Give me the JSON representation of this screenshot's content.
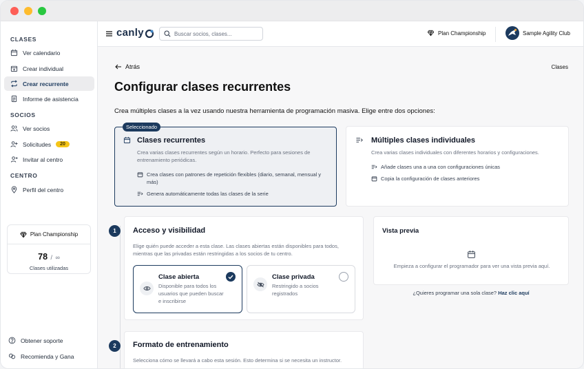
{
  "window": {
    "dots": [
      "#fe5f57",
      "#febc2e",
      "#29c840"
    ]
  },
  "brand": {
    "name": "canly"
  },
  "search": {
    "placeholder": "Buscar socios, clases..."
  },
  "topbar": {
    "plan_label": "Plan Championship",
    "club_name": "Sample Agility Club"
  },
  "sidebar": {
    "sections": [
      {
        "title": "CLASES",
        "items": [
          {
            "label": "Ver calendario",
            "icon": "calendar-icon"
          },
          {
            "label": "Crear individual",
            "icon": "calendar-plus-icon"
          },
          {
            "label": "Crear recurrente",
            "icon": "repeat-icon",
            "active": true
          },
          {
            "label": "Informe de asistencia",
            "icon": "report-icon"
          }
        ]
      },
      {
        "title": "SOCIOS",
        "items": [
          {
            "label": "Ver socios",
            "icon": "users-icon"
          },
          {
            "label": "Solicitudes",
            "icon": "user-plus-icon",
            "badge": "20"
          },
          {
            "label": "Invitar al centro",
            "icon": "user-add-icon"
          }
        ]
      },
      {
        "title": "CENTRO",
        "items": [
          {
            "label": "Perfil del centro",
            "icon": "location-pin-icon"
          }
        ]
      }
    ],
    "plan": {
      "name": "Plan Championship",
      "used": "78",
      "limit": "∞",
      "separator": "/",
      "caption": "Clases utilizadas"
    },
    "footer": [
      {
        "label": "Obtener soporte",
        "icon": "help-icon"
      },
      {
        "label": "Recomienda y Gana",
        "icon": "gift-icon"
      }
    ]
  },
  "page": {
    "back_label": "Atrás",
    "breadcrumb": "Clases",
    "title": "Configurar clases recurrentes",
    "intro": "Crea múltiples clases a la vez usando nuestra herramienta de programación masiva. Elige entre dos opciones:",
    "options": [
      {
        "selected_badge": "Seleccionado",
        "title": "Clases recurrentes",
        "desc": "Crea varias clases recurrentes según un horario. Perfecto para sesiones de entrenamiento periódicas.",
        "bullets": [
          "Crea clases con patrones de repetición flexibles (diario, semanal, mensual y más)",
          "Genera automáticamente todas las clases de la serie"
        ]
      },
      {
        "title": "Múltiples clases individuales",
        "desc": "Crea varias clases individuales con diferentes horarios y configuraciones.",
        "bullets": [
          "Añade clases una a una con configuraciones únicas",
          "Copia la configuración de clases anteriores"
        ]
      }
    ],
    "access": {
      "step": "1",
      "title": "Acceso y visibilidad",
      "desc": "Elige quién puede acceder a esta clase. Las clases abiertas están disponibles para todos, mientras que las privadas están restringidas a los socios de tu centro.",
      "choices": [
        {
          "title": "Clase abierta",
          "desc": "Disponible para todos los usuarios que pueden buscar e inscribirse",
          "selected": true
        },
        {
          "title": "Clase privada",
          "desc": "Restringido a socios registrados",
          "selected": false
        }
      ]
    },
    "preview": {
      "title": "Vista previa",
      "empty_text": "Empieza a configurar el programador para ver una vista previa aquí.",
      "question": "¿Quieres programar una sola clase?",
      "link": "Haz clic aquí"
    },
    "format": {
      "step": "2",
      "title": "Formato de entrenamiento",
      "desc": "Selecciona cómo se llevará a cabo esta sesión. Esto determina si se necesita un instructor."
    }
  },
  "colors": {
    "accent": "#1c3a5e",
    "badge": "#f5c518"
  }
}
